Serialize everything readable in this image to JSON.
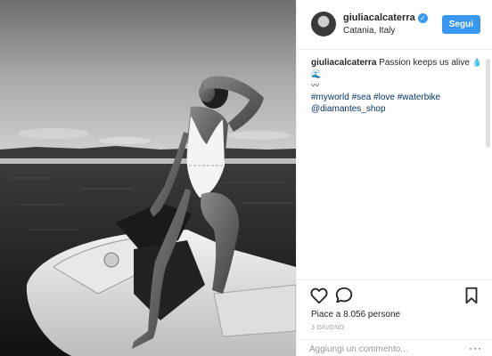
{
  "post": {
    "username": "giuliacalcaterra",
    "verified_icon": "verified-badge-icon",
    "location": "Catania, Italy",
    "follow_label": "Segui"
  },
  "caption": {
    "username": "giuliacalcaterra",
    "text": "Passion keeps us alive",
    "emoji_text": "💧🌊",
    "emoji_line2": "〰",
    "hashtags": [
      "#myworld",
      "#sea",
      "#love",
      "#waterbike"
    ],
    "mention": "@diamantes_shop"
  },
  "actions": {
    "like_icon": "heart-icon",
    "comment_icon": "comment-icon",
    "save_icon": "bookmark-icon",
    "likes_text": "Piace a 8.056 persone",
    "date": "3 GIUGNO",
    "comment_placeholder": "Aggiungi un commento...",
    "more_label": "···"
  },
  "colors": {
    "accent": "#3897f0",
    "link": "#003569",
    "muted": "#999999",
    "text": "#262626"
  }
}
